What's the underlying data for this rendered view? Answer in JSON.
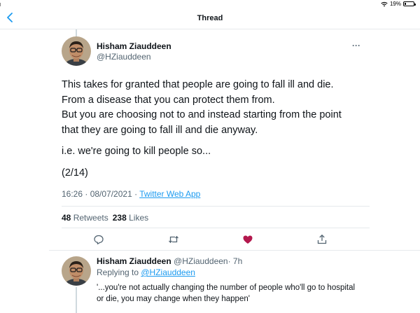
{
  "status_bar": {
    "battery": "19%",
    "battery_level": 0.19
  },
  "nav": {
    "title": "Thread"
  },
  "tweet": {
    "author_name": "Hisham Ziauddeen",
    "author_handle": "@HZiauddeen",
    "more_label": "···",
    "lines": [
      "This takes for granted that people are going to fall ill and die.",
      "From a disease that you can protect them from.",
      "But you are choosing not to and instead starting from the point",
      "that they are going to fall ill and die anyway."
    ],
    "line_2": "i.e. we're going to kill people so...",
    "counter": "(2/14)",
    "timestamp": "16:26 · 08/07/2021 · ",
    "source": "Twitter Web App",
    "retweets_count": "48",
    "retweets_label": "Retweets",
    "likes_count": "238",
    "likes_label": "Likes",
    "liked": true,
    "like_color": "#b3184d"
  },
  "reply": {
    "author_name": "Hisham Ziauddeen",
    "author_handle": "@HZiauddeen",
    "time": "· 7h",
    "replying_prefix": "Replying to ",
    "replying_handle": "@HZiauddeen",
    "text_line1": "'...you're not actually changing the number of people who'll go to hospital",
    "text_line2": "or die, you may change when they happen'"
  }
}
